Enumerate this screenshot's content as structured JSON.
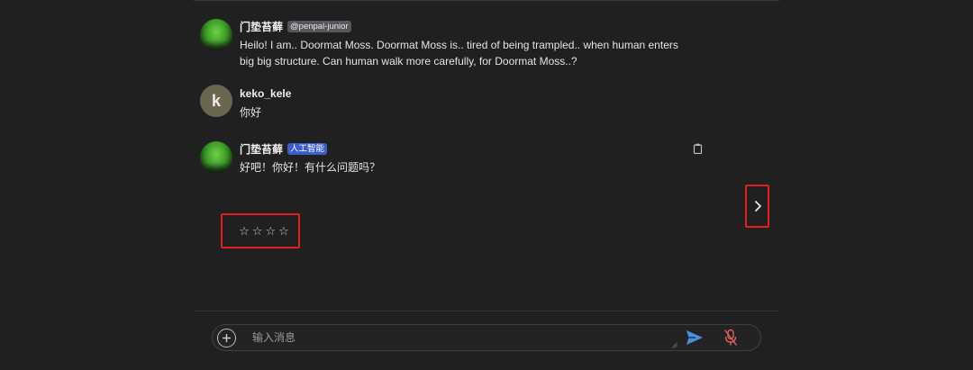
{
  "messages": [
    {
      "author": "门垫苔藓",
      "badge": "@penpal-junior",
      "text": "Heilo! I am.. Doormat Moss. Doormat Moss is.. tired of being trampled.. when human enters big big structure. Can human walk more carefully, for Doormat Moss..?"
    },
    {
      "author": "keko_kele",
      "avatar_letter": "k",
      "text": "你好"
    },
    {
      "author": "门垫苔藓",
      "badge": "人工智能",
      "text": "好吧！你好！有什么问题吗？"
    }
  ],
  "rating": {
    "stars": [
      "☆",
      "☆",
      "☆",
      "☆"
    ]
  },
  "composer": {
    "placeholder": "输入消息"
  },
  "icons": {
    "copy": "clipboard-icon",
    "next": "chevron-right-icon",
    "add": "plus-circle-icon",
    "send": "send-icon",
    "mic": "mic-off-icon"
  },
  "colors": {
    "background": "#202020",
    "highlight_border": "#e02020",
    "ai_badge": "#3b5fc9",
    "send": "#4a8fe0",
    "mic_off": "#e06060"
  }
}
